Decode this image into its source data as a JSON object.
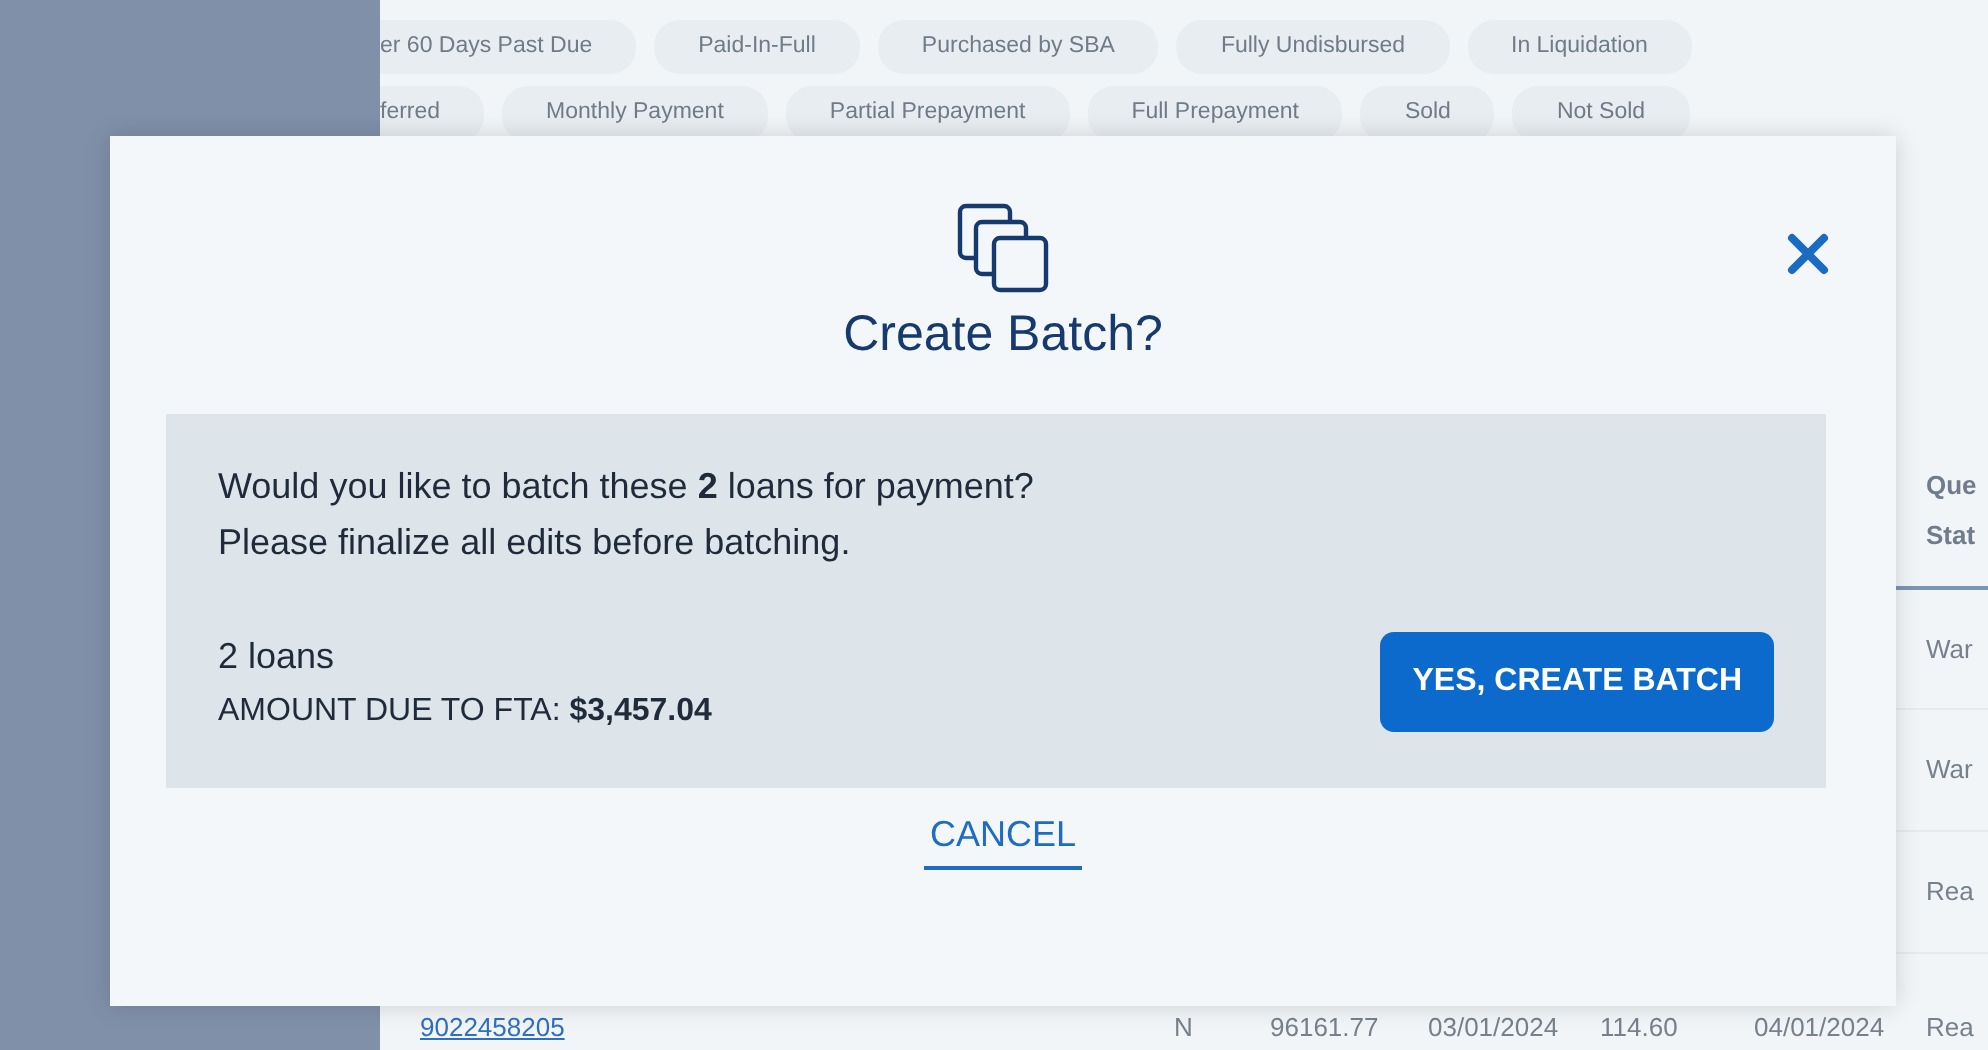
{
  "filter_chips": [
    [
      "er 60 Days Past Due",
      "Paid-In-Full",
      "Purchased by SBA",
      "Fully Undisbursed",
      "In Liquidation"
    ],
    [
      "ferred",
      "Monthly Payment",
      "Partial Prepayment",
      "Full Prepayment",
      "Sold",
      "Not Sold"
    ]
  ],
  "table": {
    "columns": [
      {
        "label": "Que Stat"
      }
    ],
    "rows": [
      {
        "queue_status": "War"
      },
      {
        "queue_status": "War"
      },
      {
        "queue_status": "Rea"
      },
      {
        "loan_number": "9022458205",
        "column_5": "N",
        "column_6": "96161.77",
        "column_7": "03/01/2024",
        "column_8": "114.60",
        "column_9": "04/01/2024",
        "queue_status": "Rea"
      }
    ]
  },
  "modal": {
    "title": "Create Batch?",
    "message": "Would you like to batch these **2** loans for payment?",
    "note": "Please finalize all edits before batching.",
    "loan_count": "2 loans",
    "amount": "AMOUNT DUE TO FTA: **$3,457.04**",
    "confirm_button": "YES, CREATE BATCH",
    "cancel_link": "CANCEL"
  }
}
